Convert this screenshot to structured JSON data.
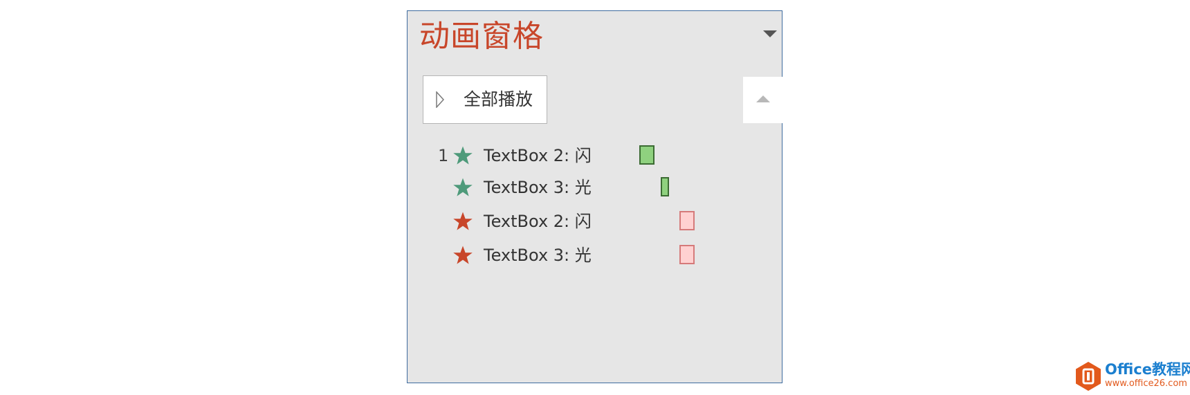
{
  "pane": {
    "title": "动画窗格",
    "play_all_label": "全部播放",
    "border_color": "#3d6b9e",
    "title_color": "#c8462a"
  },
  "animations": [
    {
      "order": "1",
      "label": "TextBox 2: 闪",
      "effect": "emphasis",
      "star_color": "#4e9a7a",
      "bar_fill": "#8fd17f",
      "bar_border": "#3b6b32"
    },
    {
      "order": "",
      "label": "TextBox 3: 光",
      "effect": "emphasis",
      "star_color": "#4e9a7a",
      "bar_fill": "#8fd17f",
      "bar_border": "#3b6b32"
    },
    {
      "order": "",
      "label": "TextBox 2: 闪",
      "effect": "exit",
      "star_color": "#c8462a",
      "bar_fill": "#ffd1d1",
      "bar_border": "#d57a7a"
    },
    {
      "order": "",
      "label": "TextBox 3: 光",
      "effect": "exit",
      "star_color": "#c8462a",
      "bar_fill": "#ffd1d1",
      "bar_border": "#d57a7a"
    }
  ],
  "icons": {
    "dropdown": "chevron-down-icon",
    "play": "play-triangle-icon",
    "scroll_up": "scroll-up-icon",
    "star": "star-icon"
  },
  "watermark": {
    "name": "Office教程网",
    "url": "www.office26.com",
    "colors": {
      "primary": "#1b7fcf",
      "accent": "#e2591c"
    }
  }
}
